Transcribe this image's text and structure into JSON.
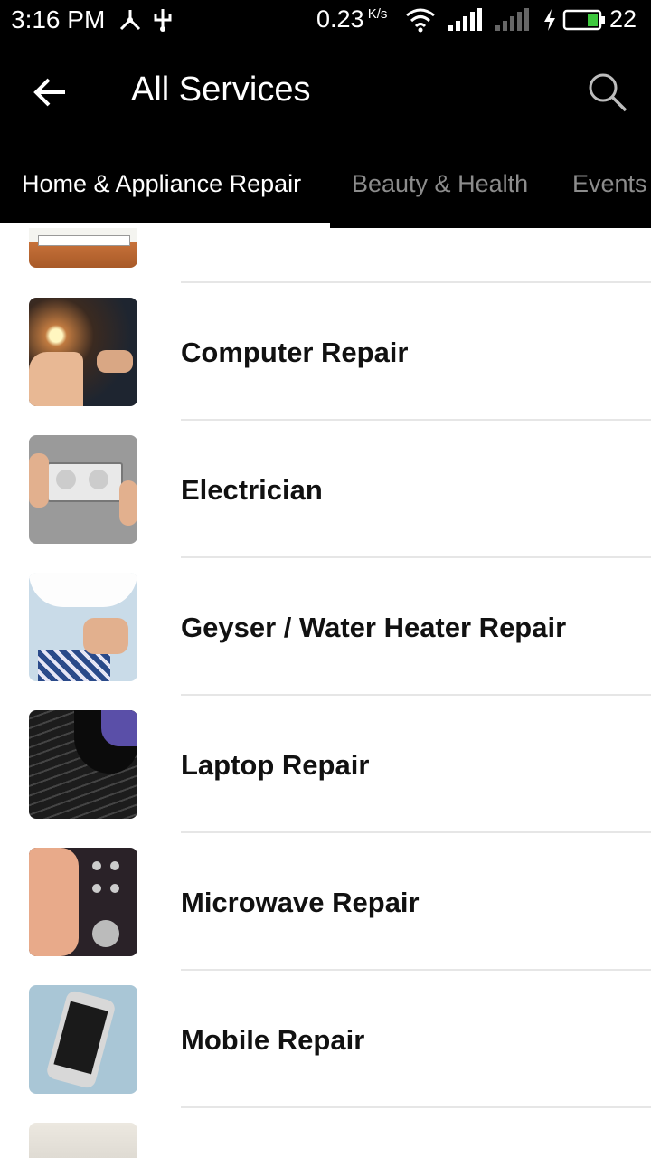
{
  "status_bar": {
    "time": "3:16 PM",
    "speed": "0.23",
    "speed_unit": "K/s",
    "battery": "22"
  },
  "app_bar": {
    "title": "All Services"
  },
  "tabs": [
    {
      "label": "Home & Appliance Repair",
      "active": true
    },
    {
      "label": "Beauty & Health",
      "active": false
    },
    {
      "label": "Events",
      "active": false
    }
  ],
  "services": [
    {
      "label": "Computer Repair",
      "icon": "computer-repair-photo"
    },
    {
      "label": "Electrician",
      "icon": "electrician-photo"
    },
    {
      "label": "Geyser / Water Heater Repair",
      "icon": "geyser-photo"
    },
    {
      "label": "Laptop Repair",
      "icon": "laptop-photo"
    },
    {
      "label": "Microwave Repair",
      "icon": "microwave-photo"
    },
    {
      "label": "Mobile Repair",
      "icon": "mobile-photo"
    }
  ]
}
